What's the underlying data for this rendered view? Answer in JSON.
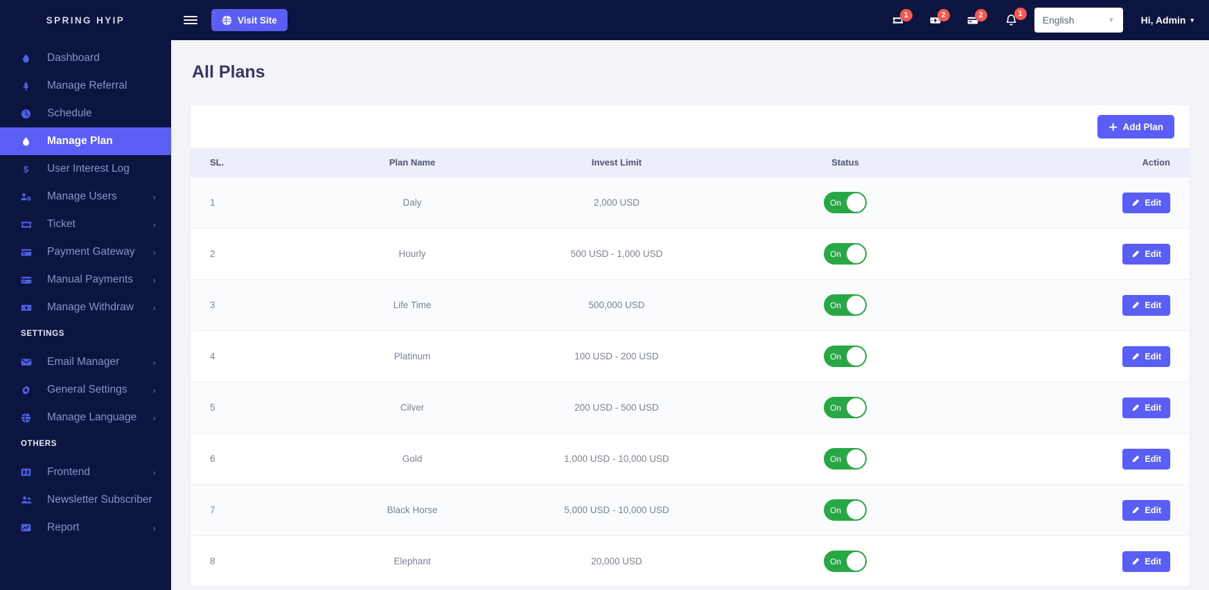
{
  "sidebar": {
    "brand": "SPRING HYIP",
    "items": [
      {
        "label": "Dashboard",
        "icon": "drop-icon",
        "caret": false,
        "active": false
      },
      {
        "label": "Manage Referral",
        "icon": "tree-icon",
        "caret": false,
        "active": false
      },
      {
        "label": "Schedule",
        "icon": "clock-icon",
        "caret": false,
        "active": false
      },
      {
        "label": "Manage Plan",
        "icon": "drop-icon",
        "caret": false,
        "active": true
      },
      {
        "label": "User Interest Log",
        "icon": "dollar-icon",
        "caret": false,
        "active": false
      },
      {
        "label": "Manage Users",
        "icon": "users-gear-icon",
        "caret": true,
        "active": false
      },
      {
        "label": "Ticket",
        "icon": "ticket-icon",
        "caret": true,
        "active": false
      },
      {
        "label": "Payment Gateway",
        "icon": "credit-card-icon",
        "caret": true,
        "active": false
      },
      {
        "label": "Manual Payments",
        "icon": "credit-card-icon",
        "caret": true,
        "active": false
      },
      {
        "label": "Manage Withdraw",
        "icon": "money-bill-icon",
        "caret": true,
        "active": false
      }
    ],
    "settings_heading": "SETTINGS",
    "settings_items": [
      {
        "label": "Email Manager",
        "icon": "envelope-icon",
        "caret": true
      },
      {
        "label": "General Settings",
        "icon": "gear-icon",
        "caret": true
      },
      {
        "label": "Manage Language",
        "icon": "globe-icon",
        "caret": true
      }
    ],
    "others_heading": "OTHERS",
    "others_items": [
      {
        "label": "Frontend",
        "icon": "columns-icon",
        "caret": true
      },
      {
        "label": "Newsletter Subscriber",
        "icon": "users-icon",
        "caret": false
      },
      {
        "label": "Report",
        "icon": "chart-icon",
        "caret": true
      }
    ],
    "caret_glyph": "›"
  },
  "topbar": {
    "menu_icon": "hamburger-icon",
    "visit_site_label": "Visit Site",
    "visit_site_icon": "globe-icon",
    "icons": [
      {
        "name": "ticket-icon",
        "badge": "1"
      },
      {
        "name": "money-bill-icon",
        "badge": "2"
      },
      {
        "name": "credit-card-icon",
        "badge": "2"
      },
      {
        "name": "bell-icon",
        "badge": "1"
      }
    ],
    "language": "English",
    "language_arrow": "▼",
    "admin_label": "Hi, Admin",
    "admin_arrow": "▾"
  },
  "main": {
    "page_title": "All Plans",
    "add_plan_label": "Add Plan",
    "add_plan_icon": "plus-icon",
    "columns": [
      "SL.",
      "Plan Name",
      "Invest Limit",
      "Status",
      "Action"
    ],
    "edit_label": "Edit",
    "edit_icon": "pencil-icon",
    "toggle_on_label": "On",
    "rows": [
      {
        "sl": "1",
        "name": "Daly",
        "limit": "2,000 USD",
        "status": "On"
      },
      {
        "sl": "2",
        "name": "Hourly",
        "limit": "500 USD - 1,000 USD",
        "status": "On"
      },
      {
        "sl": "3",
        "name": "Life Time",
        "limit": "500,000 USD",
        "status": "On"
      },
      {
        "sl": "4",
        "name": "Platinum",
        "limit": "100 USD - 200 USD",
        "status": "On"
      },
      {
        "sl": "5",
        "name": "Cilver",
        "limit": "200 USD - 500 USD",
        "status": "On"
      },
      {
        "sl": "6",
        "name": "Gold",
        "limit": "1,000 USD - 10,000 USD",
        "status": "On"
      },
      {
        "sl": "7",
        "name": "Black Horse",
        "limit": "5,000 USD - 10,000 USD",
        "status": "On"
      },
      {
        "sl": "8",
        "name": "Elephant",
        "limit": "20,000 USD",
        "status": "On"
      }
    ]
  },
  "colors": {
    "sidebar_bg": "#0c1440",
    "accent": "#5a5ef5",
    "badge": "#f4584f",
    "toggle_on": "#28a745",
    "page_bg": "#f2f4f8"
  }
}
